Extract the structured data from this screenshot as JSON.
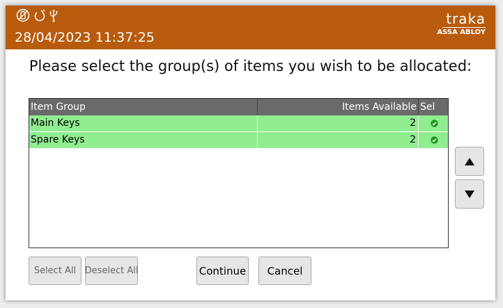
{
  "header": {
    "datetime": "28/04/2023 11:37:25",
    "status_icons": [
      "battery-icon",
      "power-icon",
      "usb-icon"
    ],
    "logo": {
      "word": "traka",
      "sub": "ASSA ABLOY"
    },
    "color": "#b85b0c"
  },
  "heading": "Please select the group(s) of items you wish to be allocated:",
  "table": {
    "columns": [
      "Item Group",
      "Items Available",
      "Sel"
    ],
    "rows": [
      {
        "group": "Main Keys",
        "available": "2",
        "selected": true
      },
      {
        "group": "Spare Keys",
        "available": "2",
        "selected": true
      }
    ],
    "row_color": "#90ed90",
    "header_color": "#6a6a6a"
  },
  "scroll": {
    "up_icon": "triangle-up-icon",
    "down_icon": "triangle-down-icon"
  },
  "buttons": {
    "select_all": "Select All",
    "deselect_all": "Deselect All",
    "continue": "Continue",
    "cancel": "Cancel"
  }
}
